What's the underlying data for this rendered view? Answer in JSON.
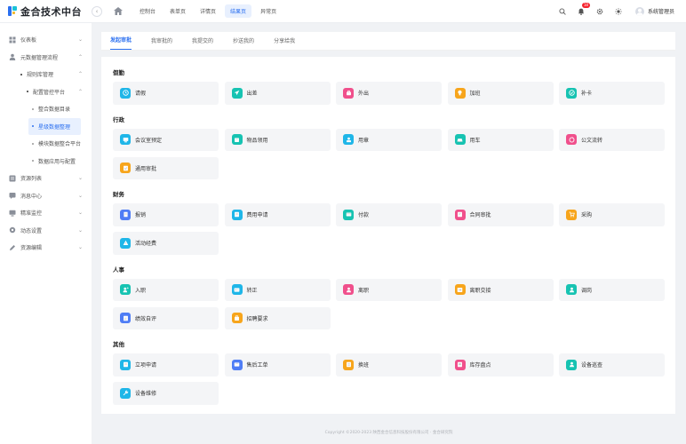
{
  "header": {
    "title": "金合技术中台",
    "tabs": [
      {
        "label": "控制台",
        "active": false
      },
      {
        "label": "表单页",
        "active": false
      },
      {
        "label": "详情页",
        "active": false
      },
      {
        "label": "结果页",
        "active": true
      },
      {
        "label": "异常页",
        "active": false
      }
    ],
    "notify_count": "18",
    "user_name": "系统管理员"
  },
  "sidebar": {
    "items": [
      {
        "label": "仪表板",
        "level": 1,
        "icon": "dashboard-icon",
        "chevron": "⌄"
      },
      {
        "label": "元数据管理流程",
        "level": 1,
        "icon": "user-icon",
        "chevron": "⌃"
      },
      {
        "label": "规则库管理",
        "level": 2,
        "chevron": "⌃"
      },
      {
        "label": "配置管控平台",
        "level": 3,
        "chevron": "⌃"
      },
      {
        "label": "整合数据目录",
        "level": 4
      },
      {
        "label": "星级数据整理",
        "level": 4,
        "active": true
      },
      {
        "label": "模块数据整合平台",
        "level": 4
      },
      {
        "label": "数据应用与配置",
        "level": 4
      },
      {
        "label": "资源列表",
        "level": 1,
        "icon": "list-icon",
        "chevron": "⌄"
      },
      {
        "label": "消息中心",
        "level": 1,
        "icon": "message-icon",
        "chevron": "⌄"
      },
      {
        "label": "精准监控",
        "level": 1,
        "icon": "monitor-icon",
        "chevron": "⌄"
      },
      {
        "label": "动态设置",
        "level": 1,
        "icon": "settings-icon",
        "chevron": "⌄"
      },
      {
        "label": "资源编辑",
        "level": 1,
        "icon": "edit-icon",
        "chevron": "⌄"
      }
    ]
  },
  "content_tabs": [
    {
      "label": "发起审批",
      "active": true
    },
    {
      "label": "我审批的",
      "active": false
    },
    {
      "label": "我提交的",
      "active": false
    },
    {
      "label": "抄送我的",
      "active": false
    },
    {
      "label": "分享给我",
      "active": false
    }
  ],
  "groups": [
    {
      "title": "假勤",
      "items": [
        {
          "label": "请假",
          "icon": "clock-icon",
          "color": "#1fb6e8"
        },
        {
          "label": "出差",
          "icon": "plane-icon",
          "color": "#17c3b2"
        },
        {
          "label": "外出",
          "icon": "bag-icon",
          "color": "#f0508c"
        },
        {
          "label": "加班",
          "icon": "bulb-icon",
          "color": "#f7a51c"
        },
        {
          "label": "补卡",
          "icon": "clock-check-icon",
          "color": "#17c3b2"
        }
      ]
    },
    {
      "title": "行政",
      "items": [
        {
          "label": "会议室预定",
          "icon": "meeting-icon",
          "color": "#1fb6e8"
        },
        {
          "label": "物品领用",
          "icon": "box-icon",
          "color": "#17c3b2"
        },
        {
          "label": "用章",
          "icon": "stamp-icon",
          "color": "#1fb6e8"
        },
        {
          "label": "用车",
          "icon": "car-icon",
          "color": "#17c3b2"
        },
        {
          "label": "公文流转",
          "icon": "document-flow-icon",
          "color": "#f0508c"
        },
        {
          "label": "通用审批",
          "icon": "approve-icon",
          "color": "#f7a51c"
        }
      ]
    },
    {
      "title": "财务",
      "items": [
        {
          "label": "报销",
          "icon": "receipt-icon",
          "color": "#4f7df5"
        },
        {
          "label": "费用申请",
          "icon": "money-doc-icon",
          "color": "#1fb6e8"
        },
        {
          "label": "付款",
          "icon": "payment-icon",
          "color": "#17c3b2"
        },
        {
          "label": "合同审批",
          "icon": "contract-icon",
          "color": "#f0508c"
        },
        {
          "label": "采购",
          "icon": "cart-icon",
          "color": "#f7a51c"
        },
        {
          "label": "活动经费",
          "icon": "fund-icon",
          "color": "#1fb6e8"
        }
      ]
    },
    {
      "title": "人事",
      "items": [
        {
          "label": "入职",
          "icon": "user-add-icon",
          "color": "#17c3b2"
        },
        {
          "label": "转正",
          "icon": "id-card-icon",
          "color": "#1fb6e8"
        },
        {
          "label": "离职",
          "icon": "user-leave-icon",
          "color": "#f0508c"
        },
        {
          "label": "离职交接",
          "icon": "handover-icon",
          "color": "#f7a51c"
        },
        {
          "label": "调岗",
          "icon": "transfer-icon",
          "color": "#17c3b2"
        },
        {
          "label": "绩效自评",
          "icon": "performance-icon",
          "color": "#4f7df5"
        },
        {
          "label": "招聘要求",
          "icon": "recruit-icon",
          "color": "#f7a51c"
        }
      ]
    },
    {
      "title": "其他",
      "items": [
        {
          "label": "立项申请",
          "icon": "project-icon",
          "color": "#1fb6e8"
        },
        {
          "label": "售后工单",
          "icon": "ticket-icon",
          "color": "#4f7df5"
        },
        {
          "label": "换班",
          "icon": "shift-icon",
          "color": "#f7a51c"
        },
        {
          "label": "库存盘点",
          "icon": "inventory-icon",
          "color": "#f0508c"
        },
        {
          "label": "设备巡查",
          "icon": "inspect-icon",
          "color": "#17c3b2"
        },
        {
          "label": "设备维修",
          "icon": "wrench-icon",
          "color": "#1fb6e8"
        }
      ]
    }
  ],
  "footer": "Copyright ©2020-2023 陕西金合信息科技股份有限公司 · 金合研究院"
}
